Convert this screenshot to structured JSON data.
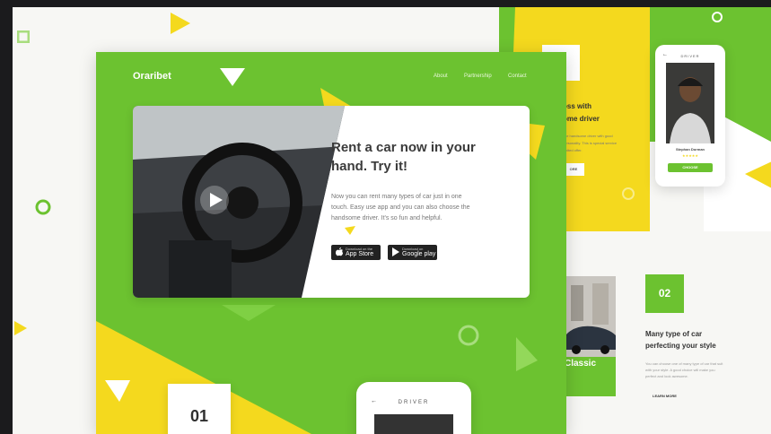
{
  "colors": {
    "green": "#6cc230",
    "yellow": "#f4d91e",
    "dark": "#1b1b1d",
    "white": "#ffffff"
  },
  "brand": "Oraribet",
  "nav": [
    "About",
    "Partnership",
    "Contact"
  ],
  "hero": {
    "title_line1": "Rent a car now in your",
    "title_line2": "hand. Try it!",
    "desc_line1": "Now you can rent many types of car just in one",
    "desc_line2": "touch. Easy use app and you can also choose the",
    "desc_line3": "handsome driver. It's so fun and helpful.",
    "play_icon": "play-icon"
  },
  "stores": [
    {
      "small": "Download on the",
      "big": "App Store",
      "icon": "apple-icon"
    },
    {
      "small": "Download on",
      "big": "Google play",
      "icon": "google-play-icon"
    }
  ],
  "step1": {
    "number": "01"
  },
  "phone_bottom": {
    "title": "DRIVER",
    "back": "←"
  },
  "right_top": {
    "heading_line1": "oss with",
    "heading_line2": "ome driver",
    "desc_line1": "ose handsome driver with good",
    "desc_line2": "personality. This is special service",
    "desc_line3": "limited offer.",
    "button": "ORE"
  },
  "phone_right": {
    "title": "DRIVER",
    "back": "←",
    "name": "Stephan Dorman",
    "stars": "★★★★★",
    "button": "CHOOSE"
  },
  "right_bottom": {
    "car_label": "Classic",
    "number": "02",
    "heading_line1": "Many type of car",
    "heading_line2": "perfecting your style",
    "desc_line1": "You can choose one of many type of car that suit",
    "desc_line2": "with your style. A good choice will make you",
    "desc_line3": "perfect and look awesome.",
    "learn_more": "LEARN MORE"
  }
}
